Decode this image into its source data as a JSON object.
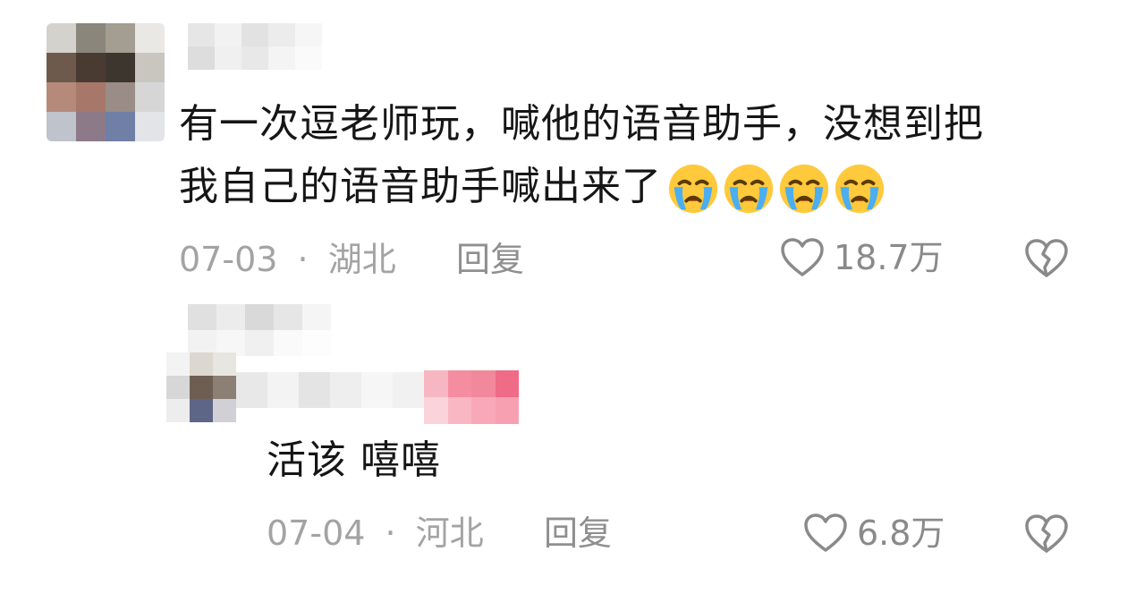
{
  "comment": {
    "text_line1": "有一次逗老师玩，喊他的语音助手，没想到把",
    "text_line2": "我自己的语音助手喊出来了",
    "emojis": [
      "crying-face",
      "crying-face",
      "crying-face",
      "crying-face"
    ],
    "date": "07-03",
    "separator": "·",
    "location": "湖北",
    "reply_label": "回复",
    "like_count": "18.7万"
  },
  "reply": {
    "text": "活该 嘻嘻",
    "date": "07-04",
    "separator": "·",
    "location": "河北",
    "reply_label": "回复",
    "like_count": "6.8万"
  },
  "colors": {
    "text": "#161616",
    "meta": "#a3a3a3",
    "icon": "#8a8a8a",
    "censored_pink": "#f07a92"
  },
  "icons": {
    "like": "heart-outline-icon",
    "dislike": "broken-heart-icon",
    "emoji": "loudly-crying-face"
  }
}
